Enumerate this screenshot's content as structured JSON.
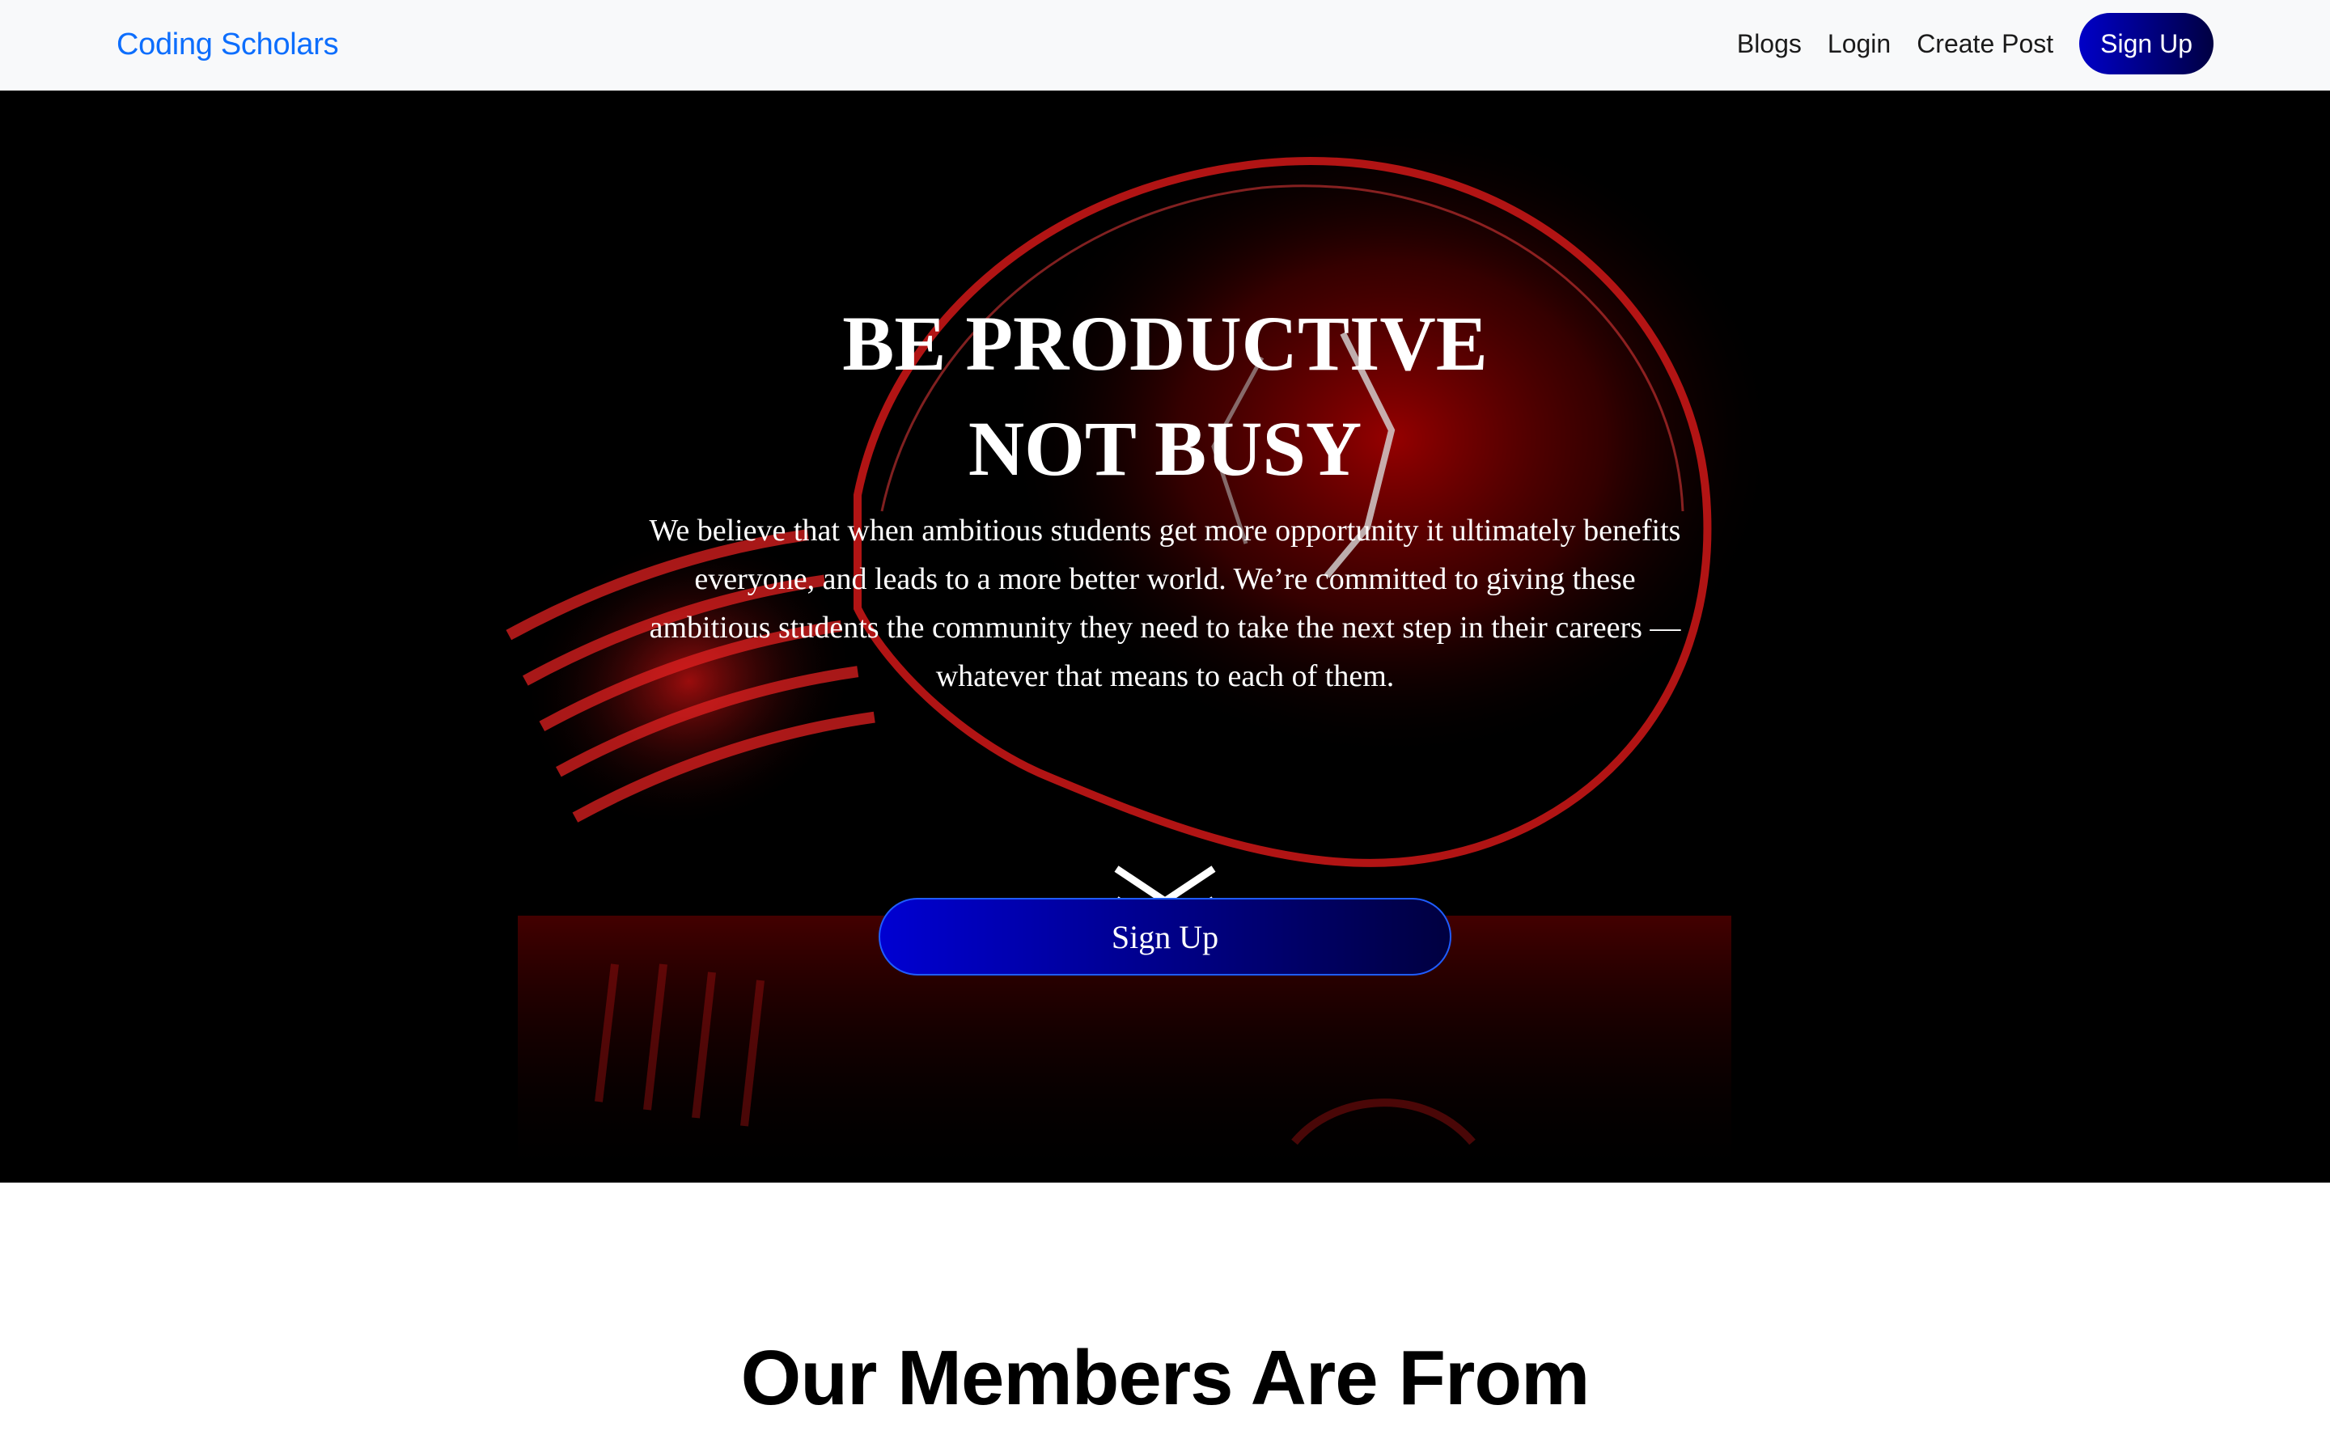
{
  "navbar": {
    "brand": "Coding Scholars",
    "links": [
      "Blogs",
      "Login",
      "Create Post"
    ],
    "signup_label": "Sign Up",
    "brand_color": "#0d6efd"
  },
  "hero": {
    "title_line1": "BE PRODUCTIVE",
    "title_line2": "NOT BUSY",
    "text": "We believe that when ambitious students get more opportunity it ultimately benefits everyone, and leads to a more better world. We’re committed to giving these ambitious students the community they need to take the next step in their careers — whatever that means to each of them.",
    "signup_label": "Sign Up",
    "scroll_icon": "double-chevron-down-icon",
    "background_icon": "light-bulb-image",
    "accent_colors": [
      "#0000c8",
      "#000042"
    ]
  },
  "members": {
    "title": "Our Members Are From"
  }
}
